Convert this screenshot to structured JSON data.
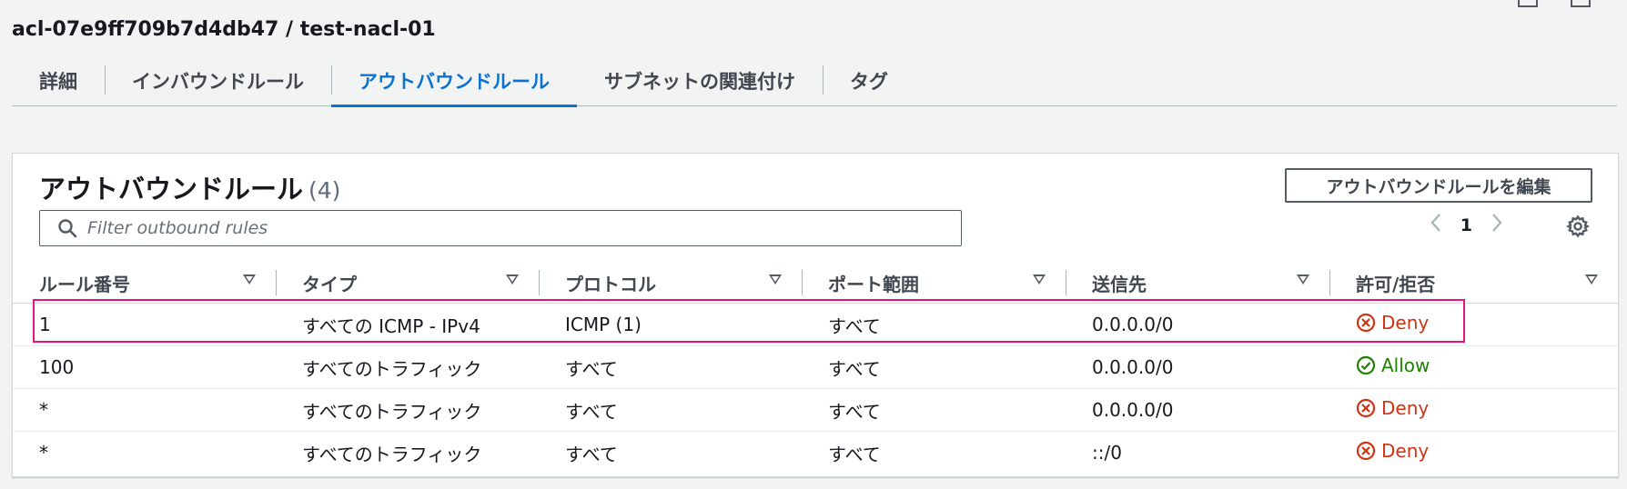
{
  "header": {
    "title": "acl-07e9ff709b7d4db47 / test-nacl-01"
  },
  "tabs": [
    {
      "label": "詳細",
      "active": false
    },
    {
      "label": "インバウンドルール",
      "active": false
    },
    {
      "label": "アウトバウンドルール",
      "active": true
    },
    {
      "label": "サブネットの関連付け",
      "active": false
    },
    {
      "label": "タグ",
      "active": false
    }
  ],
  "panel": {
    "title": "アウトバウンドルール",
    "count": "(4)",
    "edit_button": "アウトバウンドルールを編集",
    "search_placeholder": "Filter outbound rules",
    "page": "1"
  },
  "table": {
    "headers": [
      "ルール番号",
      "タイプ",
      "プロトコル",
      "ポート範囲",
      "送信先",
      "許可/拒否"
    ],
    "rows": [
      {
        "rule": "1",
        "type": "すべての ICMP - IPv4",
        "protocol": "ICMP (1)",
        "port": "すべて",
        "dest": "0.0.0.0/0",
        "action": "Deny"
      },
      {
        "rule": "100",
        "type": "すべてのトラフィック",
        "protocol": "すべて",
        "port": "すべて",
        "dest": "0.0.0.0/0",
        "action": "Allow"
      },
      {
        "rule": "*",
        "type": "すべてのトラフィック",
        "protocol": "すべて",
        "port": "すべて",
        "dest": "0.0.0.0/0",
        "action": "Deny"
      },
      {
        "rule": "*",
        "type": "すべてのトラフィック",
        "protocol": "すべて",
        "port": "すべて",
        "dest": "::/0",
        "action": "Deny"
      }
    ]
  },
  "colors": {
    "accent": "#0972d3",
    "deny": "#d13212",
    "allow": "#1d8102",
    "highlight": "#e3157e"
  },
  "icons": {
    "search": "search-icon",
    "settings": "gear-icon",
    "prev": "chevron-left-icon",
    "next": "chevron-right-icon",
    "deny": "x-circle-icon",
    "allow": "check-circle-icon",
    "sort": "sort-caret-icon"
  }
}
